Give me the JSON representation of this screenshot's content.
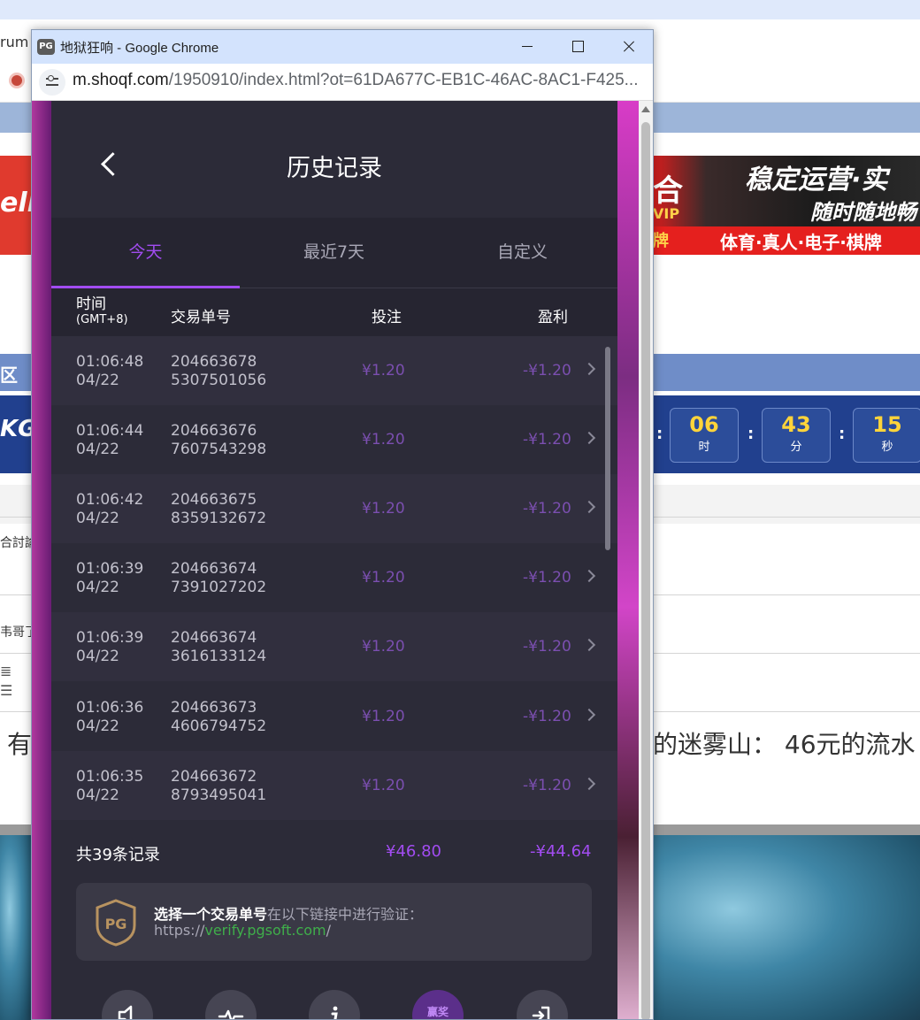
{
  "background": {
    "tab_fragment": "rum",
    "banner_left_text": "ell",
    "banner_right": {
      "headline": "稳定运营·实",
      "subline": "随时随地畅",
      "bottom": "体育·真人·电子·棋牌",
      "left_fragment": "牌",
      "vip": "VIP",
      "he": "合"
    },
    "blue_strip_fragment": "区",
    "countdown_left": "KGa",
    "countdown": [
      {
        "value": "06",
        "unit": "时"
      },
      {
        "value": "43",
        "unit": "分"
      },
      {
        "value": "15",
        "unit": "秒"
      }
    ],
    "text_fragment_1": "合討論",
    "text_fragment_2": "韦哥了",
    "big_text_left": "有",
    "big_text_right": "的迷雾山：  46元的流水"
  },
  "window": {
    "title": "地狱狂响 - Google Chrome",
    "app_icon": "PG",
    "url_host": "m.shoqf.com",
    "url_path": "/1950910/index.html?ot=61DA677C-EB1C-46AC-8AC1-F425..."
  },
  "history": {
    "title": "历史记录",
    "tabs": [
      {
        "label": "今天",
        "active": true
      },
      {
        "label": "最近7天",
        "active": false
      },
      {
        "label": "自定义",
        "active": false
      }
    ],
    "columns": {
      "time": "时间",
      "timezone": "(GMT+8)",
      "id": "交易单号",
      "bet": "投注",
      "profit": "盈利"
    },
    "rows": [
      {
        "time": "01:06:48",
        "date": "04/22",
        "id1": "204663678",
        "id2": "5307501056",
        "bet": "¥1.20",
        "profit": "-¥1.20"
      },
      {
        "time": "01:06:44",
        "date": "04/22",
        "id1": "204663676",
        "id2": "7607543298",
        "bet": "¥1.20",
        "profit": "-¥1.20"
      },
      {
        "time": "01:06:42",
        "date": "04/22",
        "id1": "204663675",
        "id2": "8359132672",
        "bet": "¥1.20",
        "profit": "-¥1.20"
      },
      {
        "time": "01:06:39",
        "date": "04/22",
        "id1": "204663674",
        "id2": "7391027202",
        "bet": "¥1.20",
        "profit": "-¥1.20"
      },
      {
        "time": "01:06:39",
        "date": "04/22",
        "id1": "204663674",
        "id2": "3616133124",
        "bet": "¥1.20",
        "profit": "-¥1.20"
      },
      {
        "time": "01:06:36",
        "date": "04/22",
        "id1": "204663673",
        "id2": "4606794752",
        "bet": "¥1.20",
        "profit": "-¥1.20"
      },
      {
        "time": "01:06:35",
        "date": "04/22",
        "id1": "204663672",
        "id2": "8793495041",
        "bet": "¥1.20",
        "profit": "-¥1.20"
      }
    ],
    "summary": {
      "count_label": "共39条记录",
      "total_bet": "¥46.80",
      "total_profit": "-¥44.64"
    },
    "verify": {
      "bold": "选择一个交易单号",
      "rest": "在以下链接中进行验证：",
      "prefix": "https://",
      "link": "verify.pgsoft.com",
      "suffix": "/"
    },
    "bottom_icons": [
      {
        "name": "sound-icon"
      },
      {
        "name": "pulse-icon"
      },
      {
        "name": "info-icon"
      },
      {
        "name": "history-icon",
        "label": "赢奖"
      },
      {
        "name": "exit-icon"
      }
    ]
  },
  "colors": {
    "accent": "#a24cf1",
    "panel_bg": "#2c2b38",
    "link_green": "#3fae4a"
  }
}
